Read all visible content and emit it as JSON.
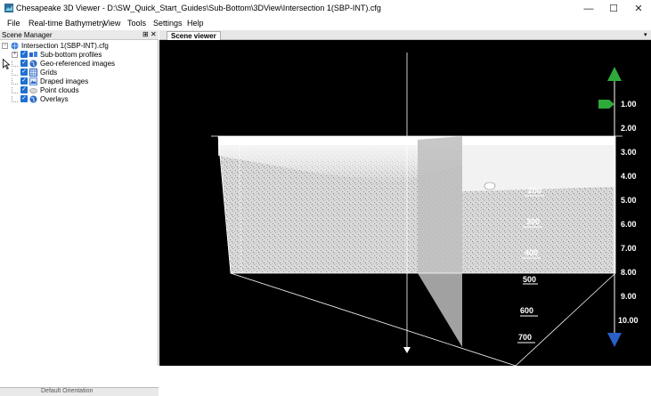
{
  "window": {
    "title": "Chesapeake 3D Viewer - D:\\SW_Quick_Start_Guides\\Sub-Bottom\\3DView\\Intersection 1(SBP-INT).cfg",
    "minimize": "—",
    "maximize": "☐",
    "close": "✕"
  },
  "menu": [
    "File",
    "Real-time Bathymetry",
    "View",
    "Tools",
    "Settings",
    "Help"
  ],
  "scene_manager": {
    "title": "Scene Manager",
    "pin": "⊞",
    "close": "✕",
    "root": "Intersection 1(SBP-INT).cfg",
    "items": [
      {
        "label": "Sub-bottom profiles",
        "icon": "sub-bottom-profiles-icon",
        "expander": "+"
      },
      {
        "label": "Geo-referenced images",
        "icon": "globe-icon"
      },
      {
        "label": "Grids",
        "icon": "grid-icon"
      },
      {
        "label": "Draped images",
        "icon": "draped-image-icon"
      },
      {
        "label": "Point clouds",
        "icon": "point-cloud-icon"
      },
      {
        "label": "Overlays",
        "icon": "globe-icon"
      }
    ],
    "bottom_text": "Default Orientation"
  },
  "scene_viewer": {
    "tab": "Scene viewer",
    "tab_menu": "▾",
    "depth_scale": [
      "1.00",
      "2.00",
      "3.00",
      "4.00",
      "5.00",
      "6.00",
      "7.00",
      "8.00",
      "9.00",
      "10.00"
    ],
    "ping_scale": [
      "200",
      "300",
      "400",
      "500",
      "600",
      "700"
    ],
    "colors": {
      "background": "#000000",
      "scale_up": "#2eaa3a",
      "scale_down": "#2a5fc8",
      "marker": "#2eaa3a"
    }
  }
}
